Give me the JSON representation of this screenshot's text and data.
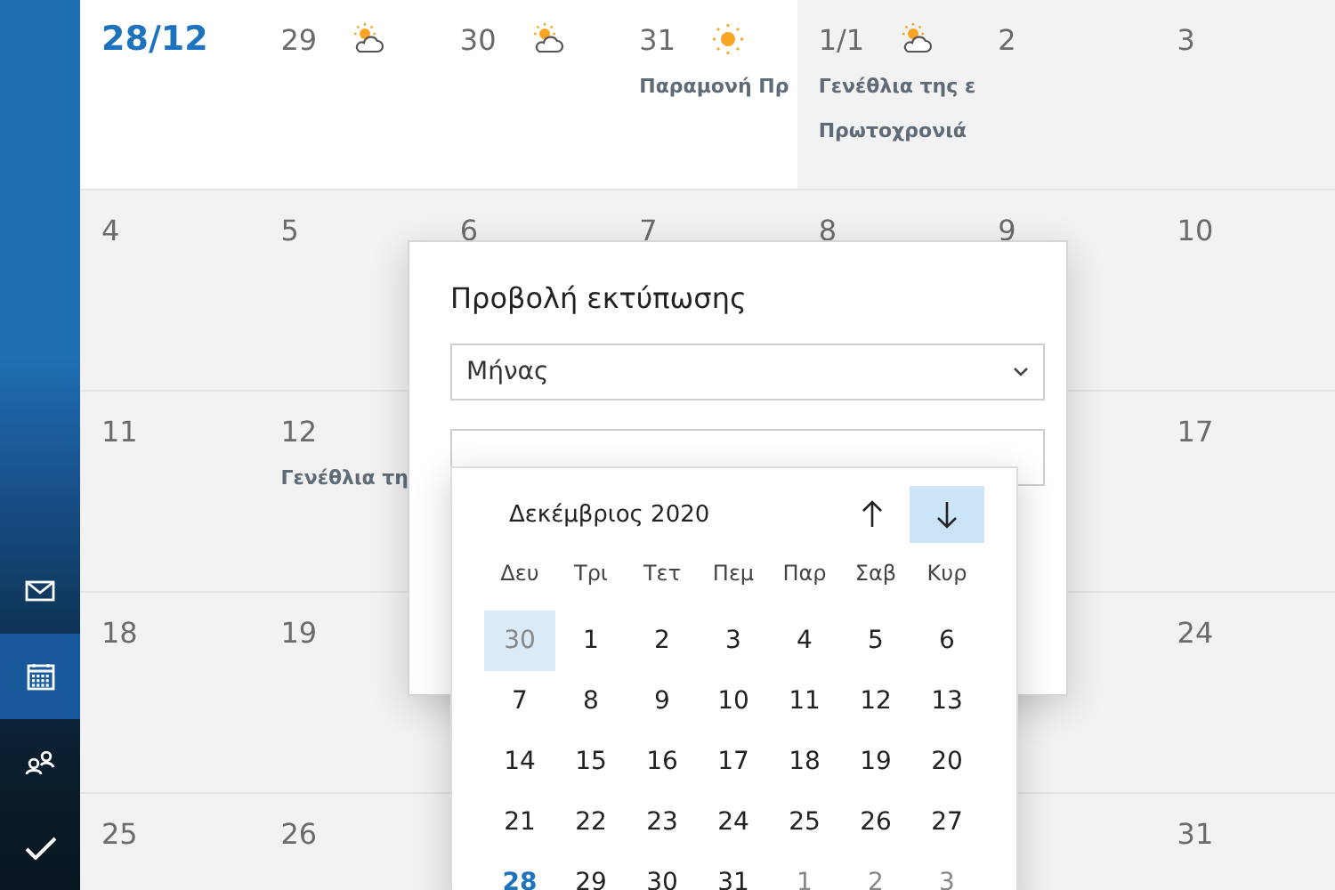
{
  "sidebar": {
    "items": [
      {
        "kind": "mail",
        "selected": false
      },
      {
        "kind": "calendar",
        "selected": true
      },
      {
        "kind": "people",
        "selected": false
      },
      {
        "kind": "todo",
        "selected": false
      }
    ]
  },
  "month_grid": {
    "weeks": [
      {
        "days": [
          {
            "label": "28/12",
            "today": true,
            "current_month": true
          },
          {
            "label": "29",
            "today": false,
            "current_month": true,
            "weather": {
              "kind": "partly_cloudy"
            }
          },
          {
            "label": "30",
            "today": false,
            "current_month": true,
            "weather": {
              "kind": "partly_cloudy"
            }
          },
          {
            "label": "31",
            "today": false,
            "current_month": true,
            "weather": {
              "kind": "sunny"
            },
            "events": [
              "Παραμονή Πρ"
            ]
          },
          {
            "label": "1/1",
            "today": false,
            "current_month": false,
            "weather": {
              "kind": "partly_cloudy"
            },
            "events": [
              "Γενέθλια της ε",
              "Πρωτοχρονιά"
            ]
          },
          {
            "label": "2",
            "today": false,
            "current_month": false
          },
          {
            "label": "3",
            "today": false,
            "current_month": false
          }
        ]
      },
      {
        "days": [
          {
            "label": "4",
            "today": false,
            "current_month": false
          },
          {
            "label": "5",
            "today": false,
            "current_month": false
          },
          {
            "label": "6",
            "today": false,
            "current_month": false
          },
          {
            "label": "7",
            "today": false,
            "current_month": false
          },
          {
            "label": "8",
            "today": false,
            "current_month": false
          },
          {
            "label": "9",
            "today": false,
            "current_month": false
          },
          {
            "label": "10",
            "today": false,
            "current_month": false
          }
        ]
      },
      {
        "days": [
          {
            "label": "11",
            "today": false,
            "current_month": false
          },
          {
            "label": "12",
            "today": false,
            "current_month": false,
            "events": [
              "Γενέθλια τη"
            ]
          },
          {
            "label": "17",
            "today": false,
            "current_month": false
          }
        ]
      },
      {
        "days": [
          {
            "label": "18",
            "today": false,
            "current_month": false
          },
          {
            "label": "19",
            "today": false,
            "current_month": false
          },
          {
            "label": "24",
            "today": false,
            "current_month": false
          }
        ]
      },
      {
        "days": [
          {
            "label": "25",
            "today": false,
            "current_month": false
          },
          {
            "label": "26",
            "today": false,
            "current_month": false
          },
          {
            "label": "31",
            "today": false,
            "current_month": false
          }
        ]
      }
    ]
  },
  "print_dialog": {
    "title": "Προβολή εκτύπωσης",
    "view_select": {
      "value": "Μήνας"
    },
    "date_picker": {
      "month": "Δεκέμβριος 2020",
      "weekdays": [
        "Δευ",
        "Τρι",
        "Τετ",
        "Πεμ",
        "Παρ",
        "Σαβ",
        "Κυρ"
      ],
      "days": [
        {
          "label": "30",
          "selected": true,
          "today": false,
          "in_month": false
        },
        {
          "label": "1",
          "selected": false,
          "today": false,
          "in_month": true
        },
        {
          "label": "2",
          "selected": false,
          "today": false,
          "in_month": true
        },
        {
          "label": "3",
          "selected": false,
          "today": false,
          "in_month": true
        },
        {
          "label": "4",
          "selected": false,
          "today": false,
          "in_month": true
        },
        {
          "label": "5",
          "selected": false,
          "today": false,
          "in_month": true
        },
        {
          "label": "6",
          "selected": false,
          "today": false,
          "in_month": true
        },
        {
          "label": "7",
          "selected": false,
          "today": false,
          "in_month": true
        },
        {
          "label": "8",
          "selected": false,
          "today": false,
          "in_month": true
        },
        {
          "label": "9",
          "selected": false,
          "today": false,
          "in_month": true
        },
        {
          "label": "10",
          "selected": false,
          "today": false,
          "in_month": true
        },
        {
          "label": "11",
          "selected": false,
          "today": false,
          "in_month": true
        },
        {
          "label": "12",
          "selected": false,
          "today": false,
          "in_month": true
        },
        {
          "label": "13",
          "selected": false,
          "today": false,
          "in_month": true
        },
        {
          "label": "14",
          "selected": false,
          "today": false,
          "in_month": true
        },
        {
          "label": "15",
          "selected": false,
          "today": false,
          "in_month": true
        },
        {
          "label": "16",
          "selected": false,
          "today": false,
          "in_month": true
        },
        {
          "label": "17",
          "selected": false,
          "today": false,
          "in_month": true
        },
        {
          "label": "18",
          "selected": false,
          "today": false,
          "in_month": true
        },
        {
          "label": "19",
          "selected": false,
          "today": false,
          "in_month": true
        },
        {
          "label": "20",
          "selected": false,
          "today": false,
          "in_month": true
        },
        {
          "label": "21",
          "selected": false,
          "today": false,
          "in_month": true
        },
        {
          "label": "22",
          "selected": false,
          "today": false,
          "in_month": true
        },
        {
          "label": "23",
          "selected": false,
          "today": false,
          "in_month": true
        },
        {
          "label": "24",
          "selected": false,
          "today": false,
          "in_month": true
        },
        {
          "label": "25",
          "selected": false,
          "today": false,
          "in_month": true
        },
        {
          "label": "26",
          "selected": false,
          "today": false,
          "in_month": true
        },
        {
          "label": "27",
          "selected": false,
          "today": false,
          "in_month": true
        },
        {
          "label": "28",
          "selected": false,
          "today": true,
          "in_month": true
        },
        {
          "label": "29",
          "selected": false,
          "today": false,
          "in_month": true
        },
        {
          "label": "30",
          "selected": false,
          "today": false,
          "in_month": true
        },
        {
          "label": "31",
          "selected": false,
          "today": false,
          "in_month": true
        },
        {
          "label": "1",
          "selected": false,
          "today": false,
          "in_month": false
        },
        {
          "label": "2",
          "selected": false,
          "today": false,
          "in_month": false
        },
        {
          "label": "3",
          "selected": false,
          "today": false,
          "in_month": false
        }
      ]
    }
  }
}
